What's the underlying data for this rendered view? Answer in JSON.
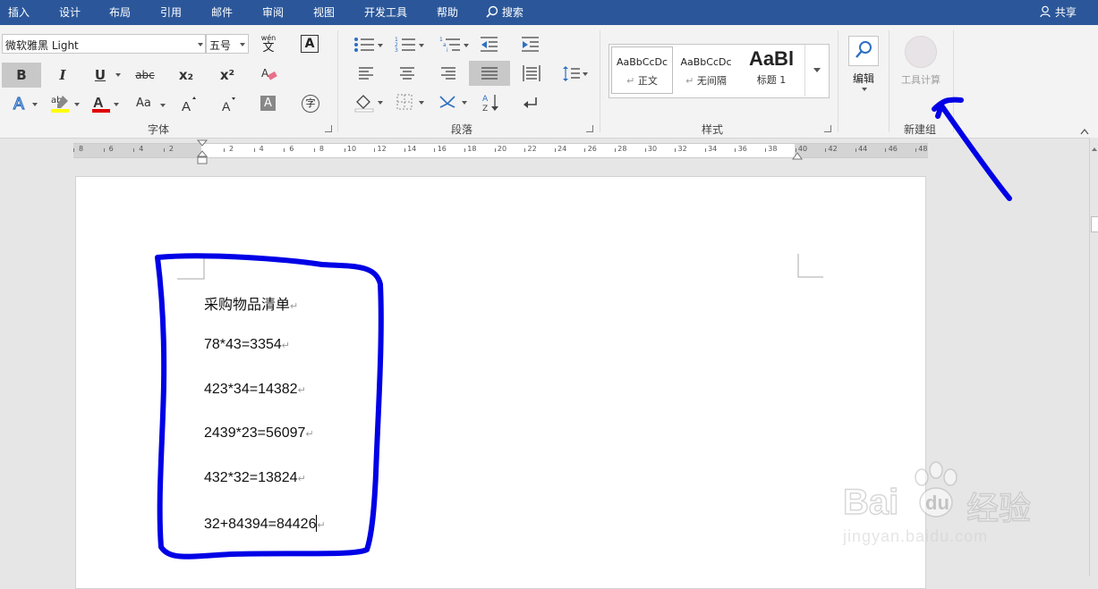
{
  "tabs": [
    "插入",
    "设计",
    "布局",
    "引用",
    "邮件",
    "审阅",
    "视图",
    "开发工具",
    "帮助"
  ],
  "search_label": "搜索",
  "share_label": "共享",
  "font": {
    "name": "微软雅黑 Light",
    "size": "五号",
    "phonetic_glyph": "wén",
    "group_label": "字体",
    "bold": "B",
    "italic": "I",
    "underline": "U",
    "strike": "abc",
    "subscript": "x₂",
    "superscript": "x²",
    "case": "Aa",
    "grow": "A",
    "shrink": "A",
    "charshade": "A",
    "enclose": "字"
  },
  "paragraph": {
    "group_label": "段落"
  },
  "styles": {
    "group_label": "样式",
    "items": [
      {
        "preview": "AaBbCcDc",
        "name": "正文"
      },
      {
        "preview": "AaBbCcDc",
        "name": "无间隔"
      },
      {
        "preview": "AaBl",
        "name": "标题 1"
      }
    ]
  },
  "editing": {
    "label": "编辑"
  },
  "custom_group": {
    "button_label": "工具计算",
    "group_label": "新建组"
  },
  "ruler": {
    "left_numbers": [
      "8",
      "6",
      "4",
      "2"
    ],
    "right_numbers": [
      "2",
      "4",
      "6",
      "8",
      "10",
      "12",
      "14",
      "16",
      "18",
      "20",
      "22",
      "24",
      "26",
      "28",
      "30",
      "32",
      "34",
      "36",
      "38",
      "40",
      "42",
      "44",
      "46",
      "48"
    ]
  },
  "document": {
    "lines": [
      "采购物品清单",
      "78*43=3354",
      "423*34=14382",
      "2439*23=56097",
      "432*32=13824",
      "32+84394=84426"
    ],
    "paragraph_mark": "↵"
  },
  "watermark": {
    "brand": "Bai",
    "brand2": "du",
    "brand_cn": "经验",
    "url": "jingyan.baidu.com"
  },
  "colors": {
    "titlebar": "#2b579a",
    "annotation": "#0000e6",
    "highlight": "#ffff00",
    "font_color": "#e00000"
  }
}
